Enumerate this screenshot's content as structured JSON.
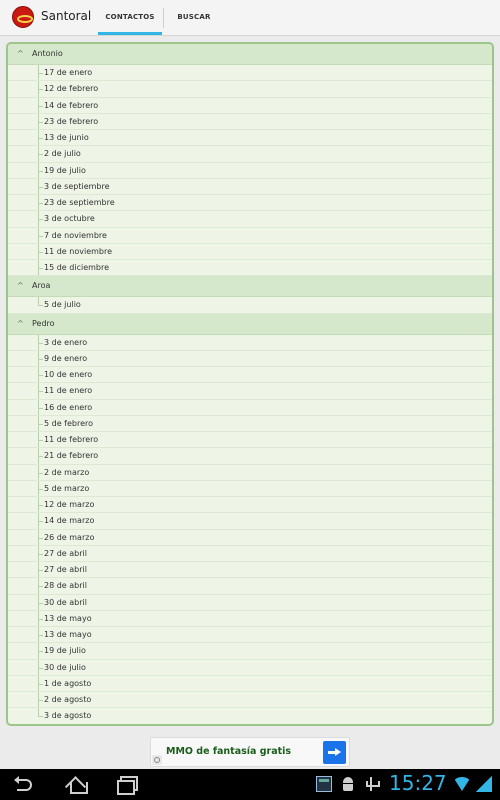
{
  "app": {
    "title": "Santoral",
    "icon": "santoral-app-icon"
  },
  "tabs": [
    {
      "label": "CONTACTOS",
      "selected": true
    },
    {
      "label": "BUSCAR",
      "selected": false
    }
  ],
  "list": {
    "groups": [
      {
        "name": "Antonio",
        "expanded": true,
        "items": [
          "17 de enero",
          "12 de febrero",
          "14 de febrero",
          "23 de febrero",
          "13 de junio",
          "2 de julio",
          "19 de julio",
          "3 de septiembre",
          "23 de septiembre",
          "3 de octubre",
          "7 de noviembre",
          "11 de noviembre",
          "15 de diciembre"
        ]
      },
      {
        "name": "Aroa",
        "expanded": true,
        "items": [
          "5 de julio"
        ]
      },
      {
        "name": "Pedro",
        "expanded": true,
        "items": [
          "3 de enero",
          "9 de enero",
          "10 de enero",
          "11 de enero",
          "16 de enero",
          "5 de febrero",
          "11 de febrero",
          "21 de febrero",
          "2 de marzo",
          "5 de marzo",
          "12 de marzo",
          "14 de marzo",
          "26 de marzo",
          "27 de abril",
          "27 de abril",
          "28 de abril",
          "30 de abril",
          "13 de mayo",
          "13 de mayo",
          "19 de julio",
          "30 de julio",
          "1 de agosto",
          "2 de agosto",
          "3 de agosto"
        ]
      }
    ]
  },
  "ad": {
    "text": "MMO de fantasía gratis"
  },
  "status_bar": {
    "clock": "15:27"
  },
  "colors": {
    "accent": "#33b5e5",
    "panel_border": "#9cc58a",
    "group_header": "#d6e8cb",
    "list_background": "#eef5e7",
    "app_icon": "#c91a12"
  }
}
